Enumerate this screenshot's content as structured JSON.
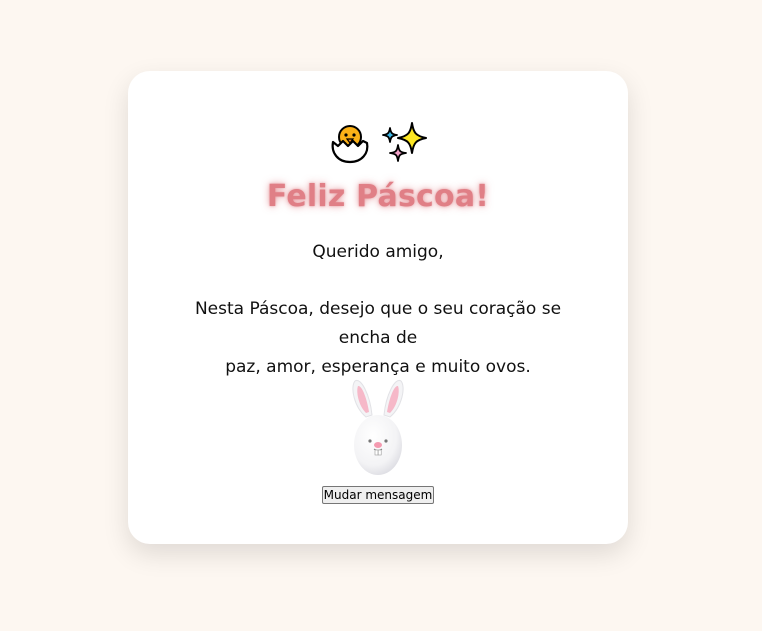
{
  "card": {
    "icons": [
      "hatching-chick-icon",
      "sparkles-icon"
    ],
    "title": "Feliz Páscoa!",
    "greeting": "Querido amigo,",
    "message_line1": "Nesta Páscoa, desejo que o seu coração se encha de",
    "message_line2": "paz, amor, esperança e muito ovos.",
    "image": "bunny-egg-icon",
    "button_label": "Mudar mensagem"
  },
  "colors": {
    "page_background": "#fdf7f1",
    "card_background": "#ffffff",
    "title": "#e07f86"
  }
}
